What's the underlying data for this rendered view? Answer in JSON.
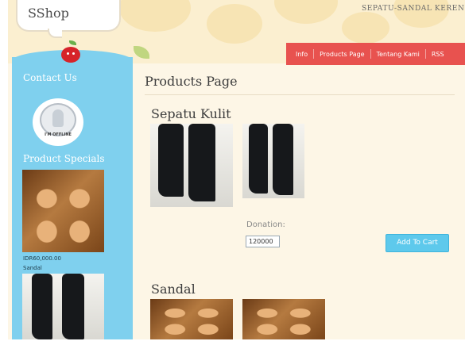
{
  "header": {
    "logo": "SShop",
    "tagline": "SEPATU-SANDAL KEREN"
  },
  "nav": {
    "items": [
      {
        "label": "Info"
      },
      {
        "label": "Products Page"
      },
      {
        "label": "Tentang Kami"
      },
      {
        "label": "RSS"
      }
    ]
  },
  "sidebar": {
    "contact_heading": "Contact Us",
    "status_badge": "I'M OFFLINE",
    "specials_heading": "Product Specials",
    "special_price": "IDR60,000.00",
    "special_name": "Sandal"
  },
  "main": {
    "title": "Products Page",
    "products": [
      {
        "name": "Sepatu Kulit",
        "donation_label": "Donation:",
        "donation_value": "120000",
        "add_to_cart": "Add To Cart"
      },
      {
        "name": "Sandal"
      }
    ]
  },
  "colors": {
    "nav_bg": "#e8524f",
    "sidebar_bg": "#7fd0ee",
    "button_bg": "#5ec9ec",
    "page_bg": "#fdf6e6"
  },
  "icons": [
    "apple-logo-icon",
    "offline-status-icon"
  ]
}
